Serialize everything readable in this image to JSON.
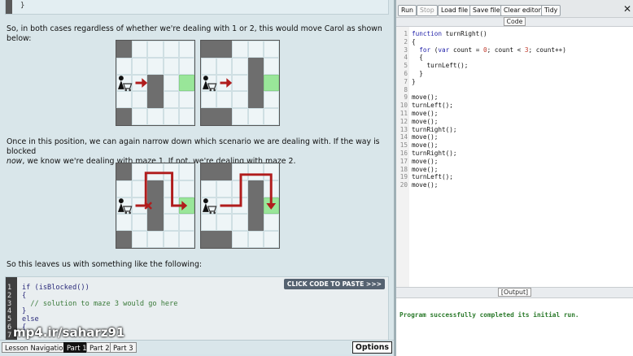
{
  "lesson": {
    "top_code_text": "}",
    "para1": "So, in both cases regardless of whether we're dealing with 1 or 2, this would move Carol as shown below:",
    "para2_a": "Once in this position, we can again narrow down which scenario we are dealing with. If the way is blocked",
    "para2_b_italic": "now",
    "para2_b_rest": ", we know we're dealing with maze 1. If not, we're dealing with maze 2.",
    "para3": "So this leaves us with something like the following:",
    "paste_button": "CLICK CODE TO PASTE >>>",
    "snippet_line_numbers": [
      "1",
      "2",
      "3",
      "4",
      "5",
      "6",
      "7"
    ],
    "snippet_lines": [
      {
        "text": "if (isBlocked())",
        "comment": false
      },
      {
        "text": "{",
        "comment": false
      },
      {
        "text": "  // solution to maze 3 would go here",
        "comment": true
      },
      {
        "text": "}",
        "comment": false
      },
      {
        "text": "else",
        "comment": false
      },
      {
        "text": "{",
        "comment": false
      },
      {
        "text": "",
        "comment": false
      }
    ]
  },
  "watermark": "mp4.ir/saharz91",
  "bottom_bar": {
    "lesson_nav": "Lesson Navigation:",
    "parts": [
      "Part 1",
      "Part 2",
      "Part 3"
    ],
    "active_part": "Part 1",
    "options": "Options"
  },
  "editor": {
    "toolbar": {
      "run": "Run",
      "stop": "Stop",
      "load_file": "Load file",
      "save_file": "Save file",
      "clear_editor": "Clear editor",
      "tidy": "Tidy",
      "close": "✕"
    },
    "code_title": "Code",
    "output_title": "[Output]",
    "output_message": "Program successfully completed its initial run.",
    "line_numbers": [
      "1",
      "2",
      "3",
      "4",
      "5",
      "6",
      "7",
      "8",
      "9",
      "10",
      "11",
      "12",
      "13",
      "14",
      "15",
      "16",
      "17",
      "18",
      "19",
      "20"
    ],
    "code_lines": [
      "function turnRight()",
      "{",
      "  for (var count = 0; count < 3; count++)",
      "  {",
      "    turnLeft();",
      "  }",
      "}",
      "",
      "move();",
      "turnLeft();",
      "move();",
      "move();",
      "turnRight();",
      "move();",
      "move();",
      "turnRight();",
      "move();",
      "move();",
      "turnLeft();",
      "move();"
    ]
  },
  "colors": {
    "wall": "#6e6e6e",
    "goal": "#99e699",
    "path": "#b01c1c",
    "output_success": "#2b7a2b"
  },
  "icons": [
    "carol-person-icon",
    "shopping-cart-icon",
    "red-arrow-icon",
    "red-path-icon",
    "close-icon"
  ]
}
